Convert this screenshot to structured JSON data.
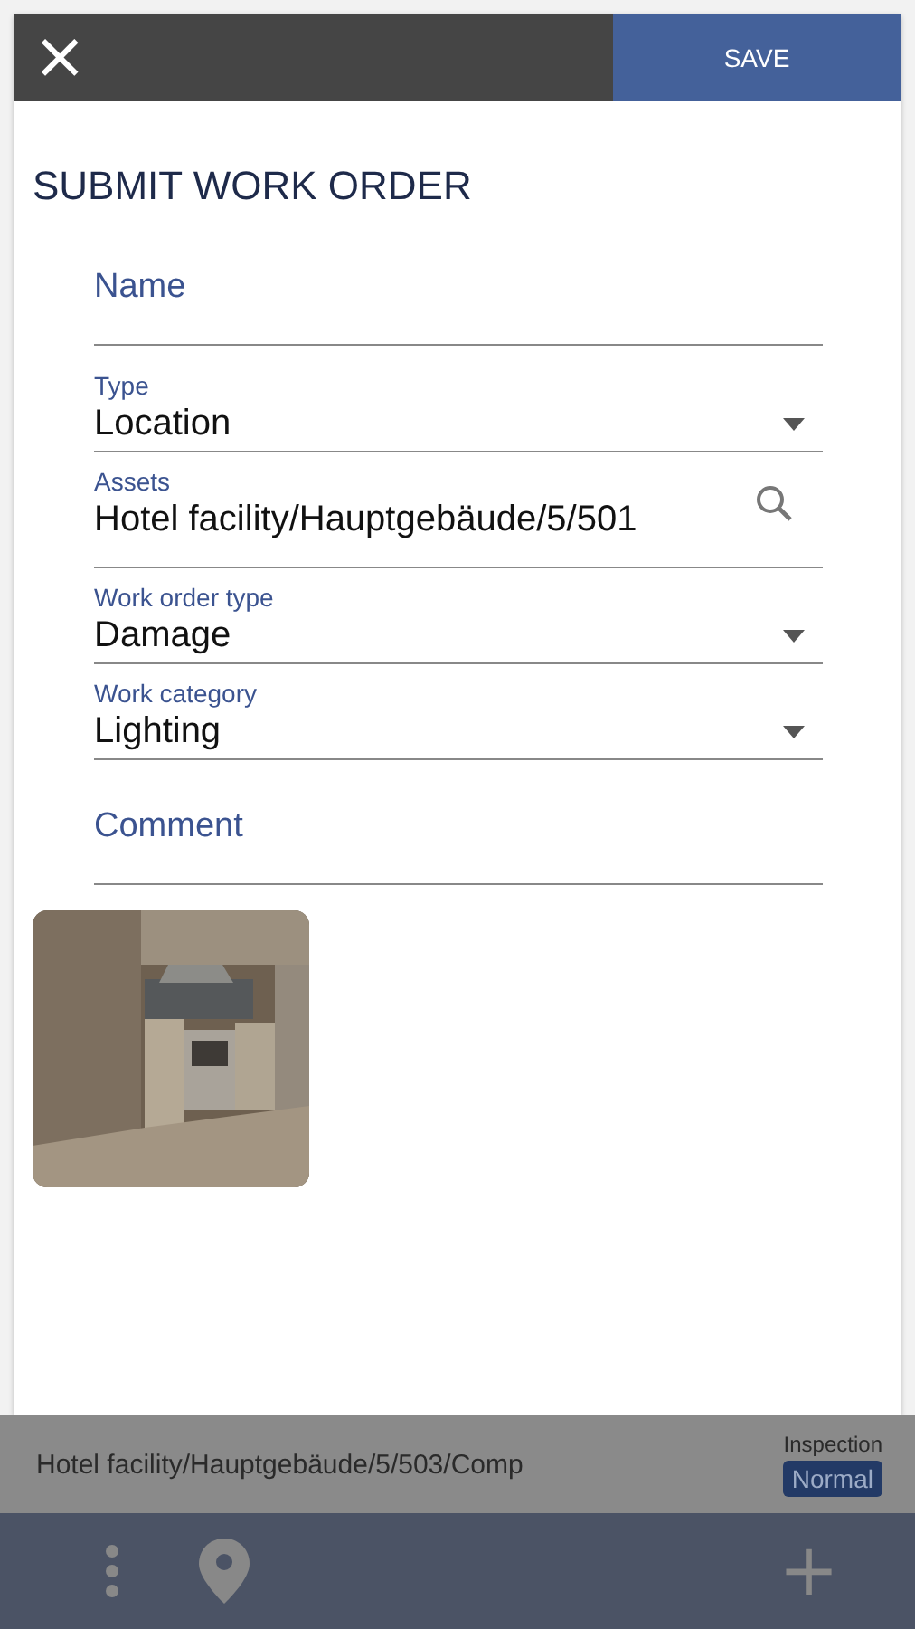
{
  "dialog": {
    "close_icon": "×",
    "save": "SAVE",
    "title": "SUBMIT WORK ORDER",
    "fields": [
      {
        "kind": "text",
        "label": "Name"
      },
      {
        "kind": "select",
        "label": "Type",
        "value": "Location"
      },
      {
        "kind": "search",
        "label": "Assets",
        "value": "Hotel facility/Hauptgebäude/5/501"
      },
      {
        "kind": "select",
        "label": "Work order type",
        "value": "Damage"
      },
      {
        "kind": "select",
        "label": "Work category",
        "value": "Lighting"
      },
      {
        "kind": "text",
        "label": "Comment"
      }
    ]
  },
  "background_list": {
    "row": {
      "path": "Hotel facility/Hauptgebäude/5/503/Comp",
      "type": "Inspection",
      "priority": "Normal"
    }
  },
  "bottom_bar": {
    "plus": "+"
  }
}
